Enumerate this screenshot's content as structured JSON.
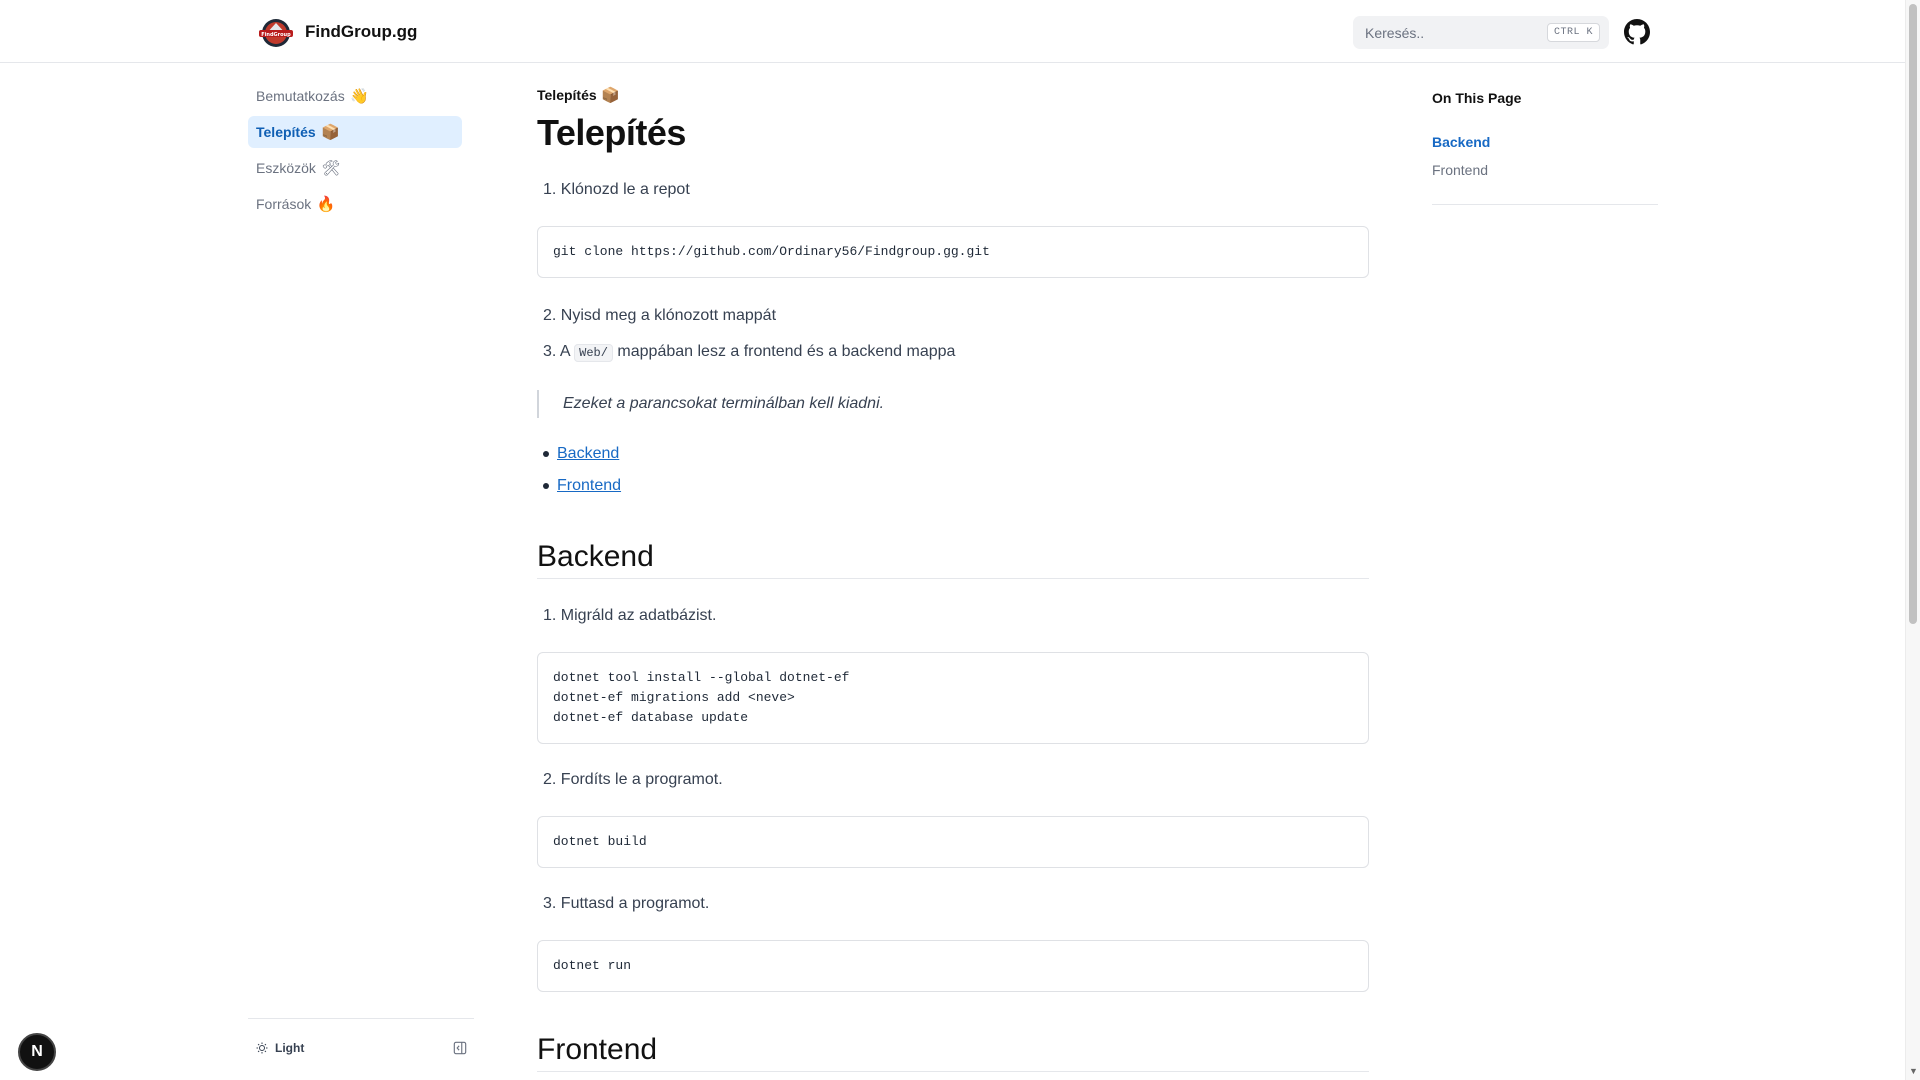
{
  "header": {
    "brand": "FindGroup.gg",
    "search_placeholder": "Keresés..",
    "search_shortcut": "CTRL K"
  },
  "sidebar": {
    "items": [
      {
        "label": "Bemutatkozás",
        "emoji": "👋",
        "active": false
      },
      {
        "label": "Telepítés",
        "emoji": "📦",
        "active": true
      },
      {
        "label": "Eszközök",
        "emoji": "🛠",
        "active": false
      },
      {
        "label": "Források",
        "emoji": "🔥",
        "active": false
      }
    ],
    "theme_label": "Light"
  },
  "badge": {
    "letter": "N"
  },
  "main": {
    "breadcrumb": "Telepítés",
    "breadcrumb_emoji": "📦",
    "title": "Telepítés",
    "steps_intro": [
      {
        "num": "1.",
        "text": "Klónozd le a repot"
      },
      {
        "num": "2.",
        "text": "Nyisd meg a klónozott mappát"
      },
      {
        "num": "3.",
        "pre": "A",
        "code": "Web/",
        "post": "mappában lesz a frontend és a backend mappa"
      }
    ],
    "clone_code": [
      "git clone https://github.com/Ordinary56/Findgroup.gg.git"
    ],
    "quote": "Ezeket a parancsokat terminálban kell kiadni.",
    "links": [
      "Backend",
      "Frontend"
    ],
    "backend": {
      "heading": "Backend",
      "step1": {
        "num": "1.",
        "text": "Migráld az adatbázist."
      },
      "code1": [
        "dotnet tool install --global dotnet-ef",
        "dotnet-ef migrations add <neve>",
        "dotnet-ef database update"
      ],
      "step2": {
        "num": "2.",
        "text": "Fordíts le a programot."
      },
      "code2": [
        "dotnet build"
      ],
      "step3": {
        "num": "3.",
        "text": "Futtasd a programot."
      },
      "code3": [
        "dotnet run"
      ]
    },
    "frontend": {
      "heading": "Frontend"
    }
  },
  "toc": {
    "title": "On This Page",
    "items": [
      {
        "label": "Backend",
        "active": true
      },
      {
        "label": "Frontend",
        "active": false
      }
    ]
  }
}
